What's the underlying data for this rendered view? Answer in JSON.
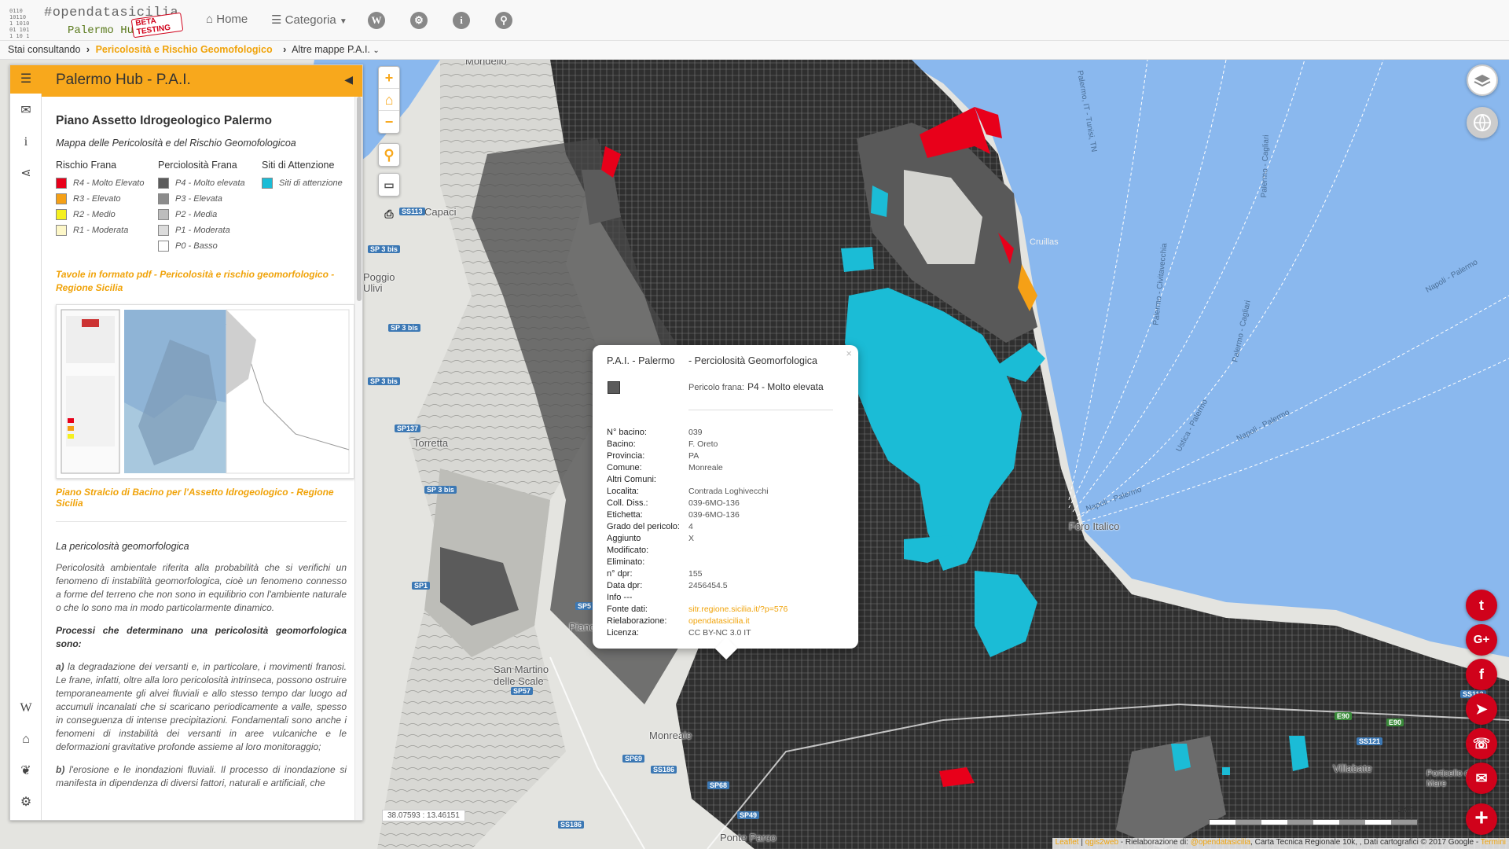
{
  "navbar": {
    "logo_tag": "#opendatasicilia",
    "logo_hub": "Palermo Hub",
    "beta": "BETA TESTING",
    "home_label": "Home",
    "category_label": "Categoria",
    "icons": [
      "wikipedia-icon",
      "settings-icon",
      "info-icon",
      "search-icon"
    ],
    "wiki_glyph": "W",
    "info_glyph": "i"
  },
  "breadcrumb": {
    "prefix": "Stai consultando",
    "active": "Pericolosità e Rischio Geomofologico",
    "other": "Altre mappe P.A.I."
  },
  "sidebar": {
    "header": "Palermo Hub - P.A.I.",
    "title": "Piano Assetto Idrogeologico Palermo",
    "subtitle": "Mappa delle Pericolosità e del Rischio Geomofologicoa",
    "legend": {
      "rischio": {
        "title": "Rischio Frana",
        "items": [
          {
            "label": "R4 - Molto Elevato",
            "color": "#e8001a"
          },
          {
            "label": "R3 - Elevato",
            "color": "#f5a016"
          },
          {
            "label": "R2 - Medio",
            "color": "#f5f020"
          },
          {
            "label": "R1 - Moderata",
            "color": "#fdf7c8"
          }
        ]
      },
      "pericolosita": {
        "title": "Perciolosità Frana",
        "items": [
          {
            "label": "P4 - Molto elevata",
            "color": "#5b5b5b"
          },
          {
            "label": "P3 - Elevata",
            "color": "#8c8c8c"
          },
          {
            "label": "P2 - Media",
            "color": "#bdbdbd"
          },
          {
            "label": "P1 - Moderata",
            "color": "#dcdcdc"
          },
          {
            "label": "P0 - Basso",
            "color": "#ffffff"
          }
        ]
      },
      "siti": {
        "title": "Siti di Attenzione",
        "items": [
          {
            "label": "Siti di attenzione",
            "color": "#1bbcd6"
          }
        ]
      }
    },
    "pdf_link": "Tavole in formato pdf - Pericolosità e rischio geomorfologico - Regione Sicilia",
    "pdf_caption": "Piano Stralcio di Bacino per l'Assetto Idrogeologico - Regione Sicilia",
    "section_title": "La pericolosità geomorfologica",
    "para1": "Pericolosità ambientale riferita alla probabilità che si verifichi un fenomeno di instabilità geomorfologica, cioè un fenomeno connesso a forme del terreno che non sono in equilibrio con l'ambiente naturale o che lo sono ma in modo particolarmente dinamico.",
    "para2": "Processi che determinano una pericolosità geomorfologica sono:",
    "para3_lead": "a)",
    "para3": " la degradazione dei versanti e, in particolare, i movimenti franosi. Le frane, infatti, oltre alla loro pericolosità intrinseca, possono ostruire temporaneamente gli alvei fluviali e allo stesso tempo dar luogo ad accumuli incanalati che si scaricano periodicamente a valle, spesso in conseguenza di intense precipitazioni. Fondamentali sono anche i fenomeni di instabilità dei versanti in aree vulcaniche e le deformazioni gravitative profonde assieme al loro monitoraggio;",
    "para4_lead": "b)",
    "para4": " l'erosione e le inondazioni fluviali. Il processo di inondazione si manifesta in dipendenza di diversi fattori, naturali e artificiali, che"
  },
  "popup": {
    "title_left": "P.A.I. - Palermo",
    "title_right": "- Perciolosità Geomorfologica",
    "pericolo_label": "Pericolo frana:",
    "pericolo_value": "P4 - Molto elevata",
    "rows": [
      {
        "k": "N° bacino:",
        "v": "039"
      },
      {
        "k": "Bacino:",
        "v": "F. Oreto"
      },
      {
        "k": "Provincia:",
        "v": "PA"
      },
      {
        "k": "Comune:",
        "v": "Monreale"
      },
      {
        "k": "Altri Comuni:",
        "v": ""
      },
      {
        "k": "Localita:",
        "v": "Contrada Loghivecchi"
      },
      {
        "k": "Coll. Diss.:",
        "v": "039-6MO-136"
      },
      {
        "k": "Etichetta:",
        "v": "039-6MO-136"
      },
      {
        "k": "Grado del pericolo:",
        "v": "4"
      },
      {
        "k": "Aggiunto",
        "v": "X"
      },
      {
        "k": "Modificato:",
        "v": ""
      },
      {
        "k": "Eliminato:",
        "v": ""
      },
      {
        "k": "n° dpr:",
        "v": "155"
      },
      {
        "k": "Data dpr:",
        "v": "2456454.5"
      },
      {
        "k": "Info ---",
        "v": ""
      },
      {
        "k": "Fonte dati:",
        "v": "sitr.regione.sicilia.it/?p=576",
        "link": true
      },
      {
        "k": "Rielaborazione:",
        "v": "opendatasicilia.it",
        "link": true
      },
      {
        "k": "Licenza:",
        "v": "CC BY-NC 3.0 IT"
      }
    ]
  },
  "map": {
    "coords": "38.07593 : 13.46151",
    "scale": "3km",
    "places": [
      {
        "t": "Capaci"
      },
      {
        "t": "Torretta"
      },
      {
        "t": "Piano"
      },
      {
        "t": "San Martino delle Scale"
      },
      {
        "t": "Monreale"
      },
      {
        "t": "Foro Italico"
      },
      {
        "t": "Villabate"
      },
      {
        "t": "Ponte Parco"
      },
      {
        "t": "Porticello di Mare"
      },
      {
        "t": "Cruillas"
      },
      {
        "t": "Poggio Ulivi"
      },
      {
        "t": "Mondello"
      }
    ],
    "roads": [
      "SS113",
      "SP 3 bis",
      "SP 3 bis",
      "SP 3 bis",
      "SP137",
      "SP 3 bis",
      "SP1",
      "SP5",
      "SP57",
      "SP69",
      "SS186",
      "SP68",
      "SP49",
      "SS186",
      "SS113",
      "E90",
      "E90",
      "SS121"
    ],
    "sea_labels": [
      "Napoli - Palermo",
      "Napoli - Palermo",
      "Napoli - Palermo",
      "Palermo - Cagliari",
      "Palermo - Civitavecchia",
      "Palermo, IT - Tunisi, TN",
      "Ustica - Palermo",
      "Palermo - Cagliari"
    ]
  },
  "social": [
    "twitter-icon",
    "google-plus-icon",
    "facebook-icon",
    "telegram-icon",
    "whatsapp-icon",
    "email-icon",
    "add-icon"
  ],
  "social_glyphs": {
    "twitter": "t",
    "gplus": "G+",
    "facebook": "f",
    "telegram": "➤",
    "whatsapp": "☏",
    "email": "✉",
    "plus": "+"
  },
  "attribution": {
    "leaflet": "Leaflet",
    "qgis": "qgis2web",
    "rest": " - Rielaborazione di: ",
    "author": "@opendatasicilia",
    "tail": ", Carta Tecnica Regionale 10k, , Dati cartografici © 2017 Google - ",
    "terms": "Termini"
  },
  "colors": {
    "accent": "#f8a81c",
    "social": "#d0021b",
    "sea": "#8ab8ee",
    "sites": "#1bbcd6"
  }
}
